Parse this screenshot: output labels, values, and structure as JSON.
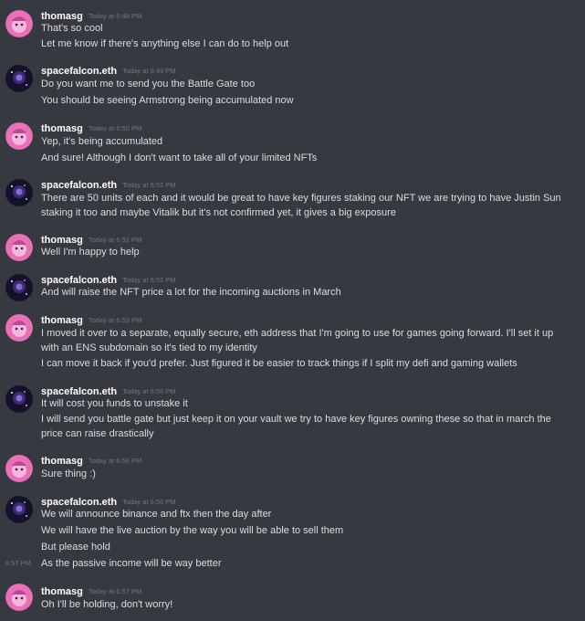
{
  "messages": [
    {
      "author": "thomasg",
      "time": "Today at 6:48 PM",
      "avatar": "thomas-avatar-icon",
      "lines": [
        "That's so cool",
        "Let me know if there's anything else I can do to help out"
      ]
    },
    {
      "author": "spacefalcon.eth",
      "time": "Today at 6:49 PM",
      "avatar": "spacefalcon-avatar-icon",
      "lines": [
        "Do you want me to send you the Battle Gate too",
        "You should be seeing Armstrong being accumulated now"
      ]
    },
    {
      "author": "thomasg",
      "time": "Today at 6:50 PM",
      "avatar": "thomas-avatar-icon",
      "lines": [
        "Yep, it's being accumulated",
        "And sure! Although I don't want to take all of your limited NFTs"
      ]
    },
    {
      "author": "spacefalcon.eth",
      "time": "Today at 6:52 PM",
      "avatar": "spacefalcon-avatar-icon",
      "lines": [
        "There are 50 units of each and it would be great to have key figures staking our NFT we are trying to have Justin Sun staking it too and maybe Vitalik but it's not confirmed yet, it gives a big exposure"
      ]
    },
    {
      "author": "thomasg",
      "time": "Today at 6:52 PM",
      "avatar": "thomas-avatar-icon",
      "lines": [
        "Well I'm happy to help"
      ]
    },
    {
      "author": "spacefalcon.eth",
      "time": "Today at 6:52 PM",
      "avatar": "spacefalcon-avatar-icon",
      "lines": [
        "And will raise the NFT price a lot for the incoming auctions in March"
      ]
    },
    {
      "author": "thomasg",
      "time": "Today at 6:53 PM",
      "avatar": "thomas-avatar-icon",
      "lines": [
        "I moved it over to a separate, equally secure, eth address that I'm going to use for games going forward. I'll set it up with an ENS subdomain so it's tied to my identity",
        "I can move it back if you'd prefer. Just figured it be easier to track things if I split my defi and gaming wallets"
      ]
    },
    {
      "author": "spacefalcon.eth",
      "time": "Today at 6:55 PM",
      "avatar": "spacefalcon-avatar-icon",
      "lines": [
        "It will cost you funds to unstake it",
        "I will send you battle gate but just keep it on your vault we try to have key figures owning these so that in march the price can raise drastically"
      ]
    },
    {
      "author": "thomasg",
      "time": "Today at 6:56 PM",
      "avatar": "thomas-avatar-icon",
      "lines": [
        "Sure thing :)"
      ]
    },
    {
      "author": "spacefalcon.eth",
      "time": "Today at 6:56 PM",
      "avatar": "spacefalcon-avatar-icon",
      "lines": [
        "We will announce binance and ftx then the day after",
        "We will have the live auction by the way you will be able to sell them",
        "But please hold"
      ]
    },
    {
      "author": "thomasg",
      "time": "Today at 6:57 PM",
      "avatar": "thomas-avatar-icon",
      "lines": [
        "Oh I'll be holding, don't worry!"
      ]
    }
  ],
  "continuation": {
    "time": "6:57 PM",
    "text": "As the passive income will be way better"
  },
  "colors": {
    "background": "#36393f",
    "author": "#ffffff",
    "text": "#dcddde",
    "timestamp": "#72767d"
  }
}
